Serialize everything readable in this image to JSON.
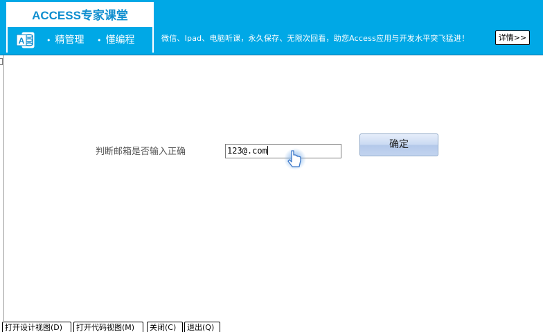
{
  "banner": {
    "logo_title": "ACCESS专家课堂",
    "slogan_items": [
      "精管理",
      "懂编程"
    ],
    "bullet": "•",
    "tagline": "微信、Ipad、电脑听课，永久保存、无限次回看，助您Access应用与开发水平突飞猛进！",
    "details_label": "详情>>",
    "icon": "access-icon",
    "colors": {
      "banner_bg": "#00a8e6",
      "logo_text": "#0f8ecf"
    }
  },
  "form": {
    "label": "判断邮箱是否输入正确",
    "email_value": "123@.com",
    "confirm_label": "确定",
    "cursor_icon": "hand-pointer-icon"
  },
  "bottom_buttons": [
    "打开设计视图(D)",
    "打开代码视图(M)",
    "关闭(C)",
    "退出(Q)"
  ]
}
